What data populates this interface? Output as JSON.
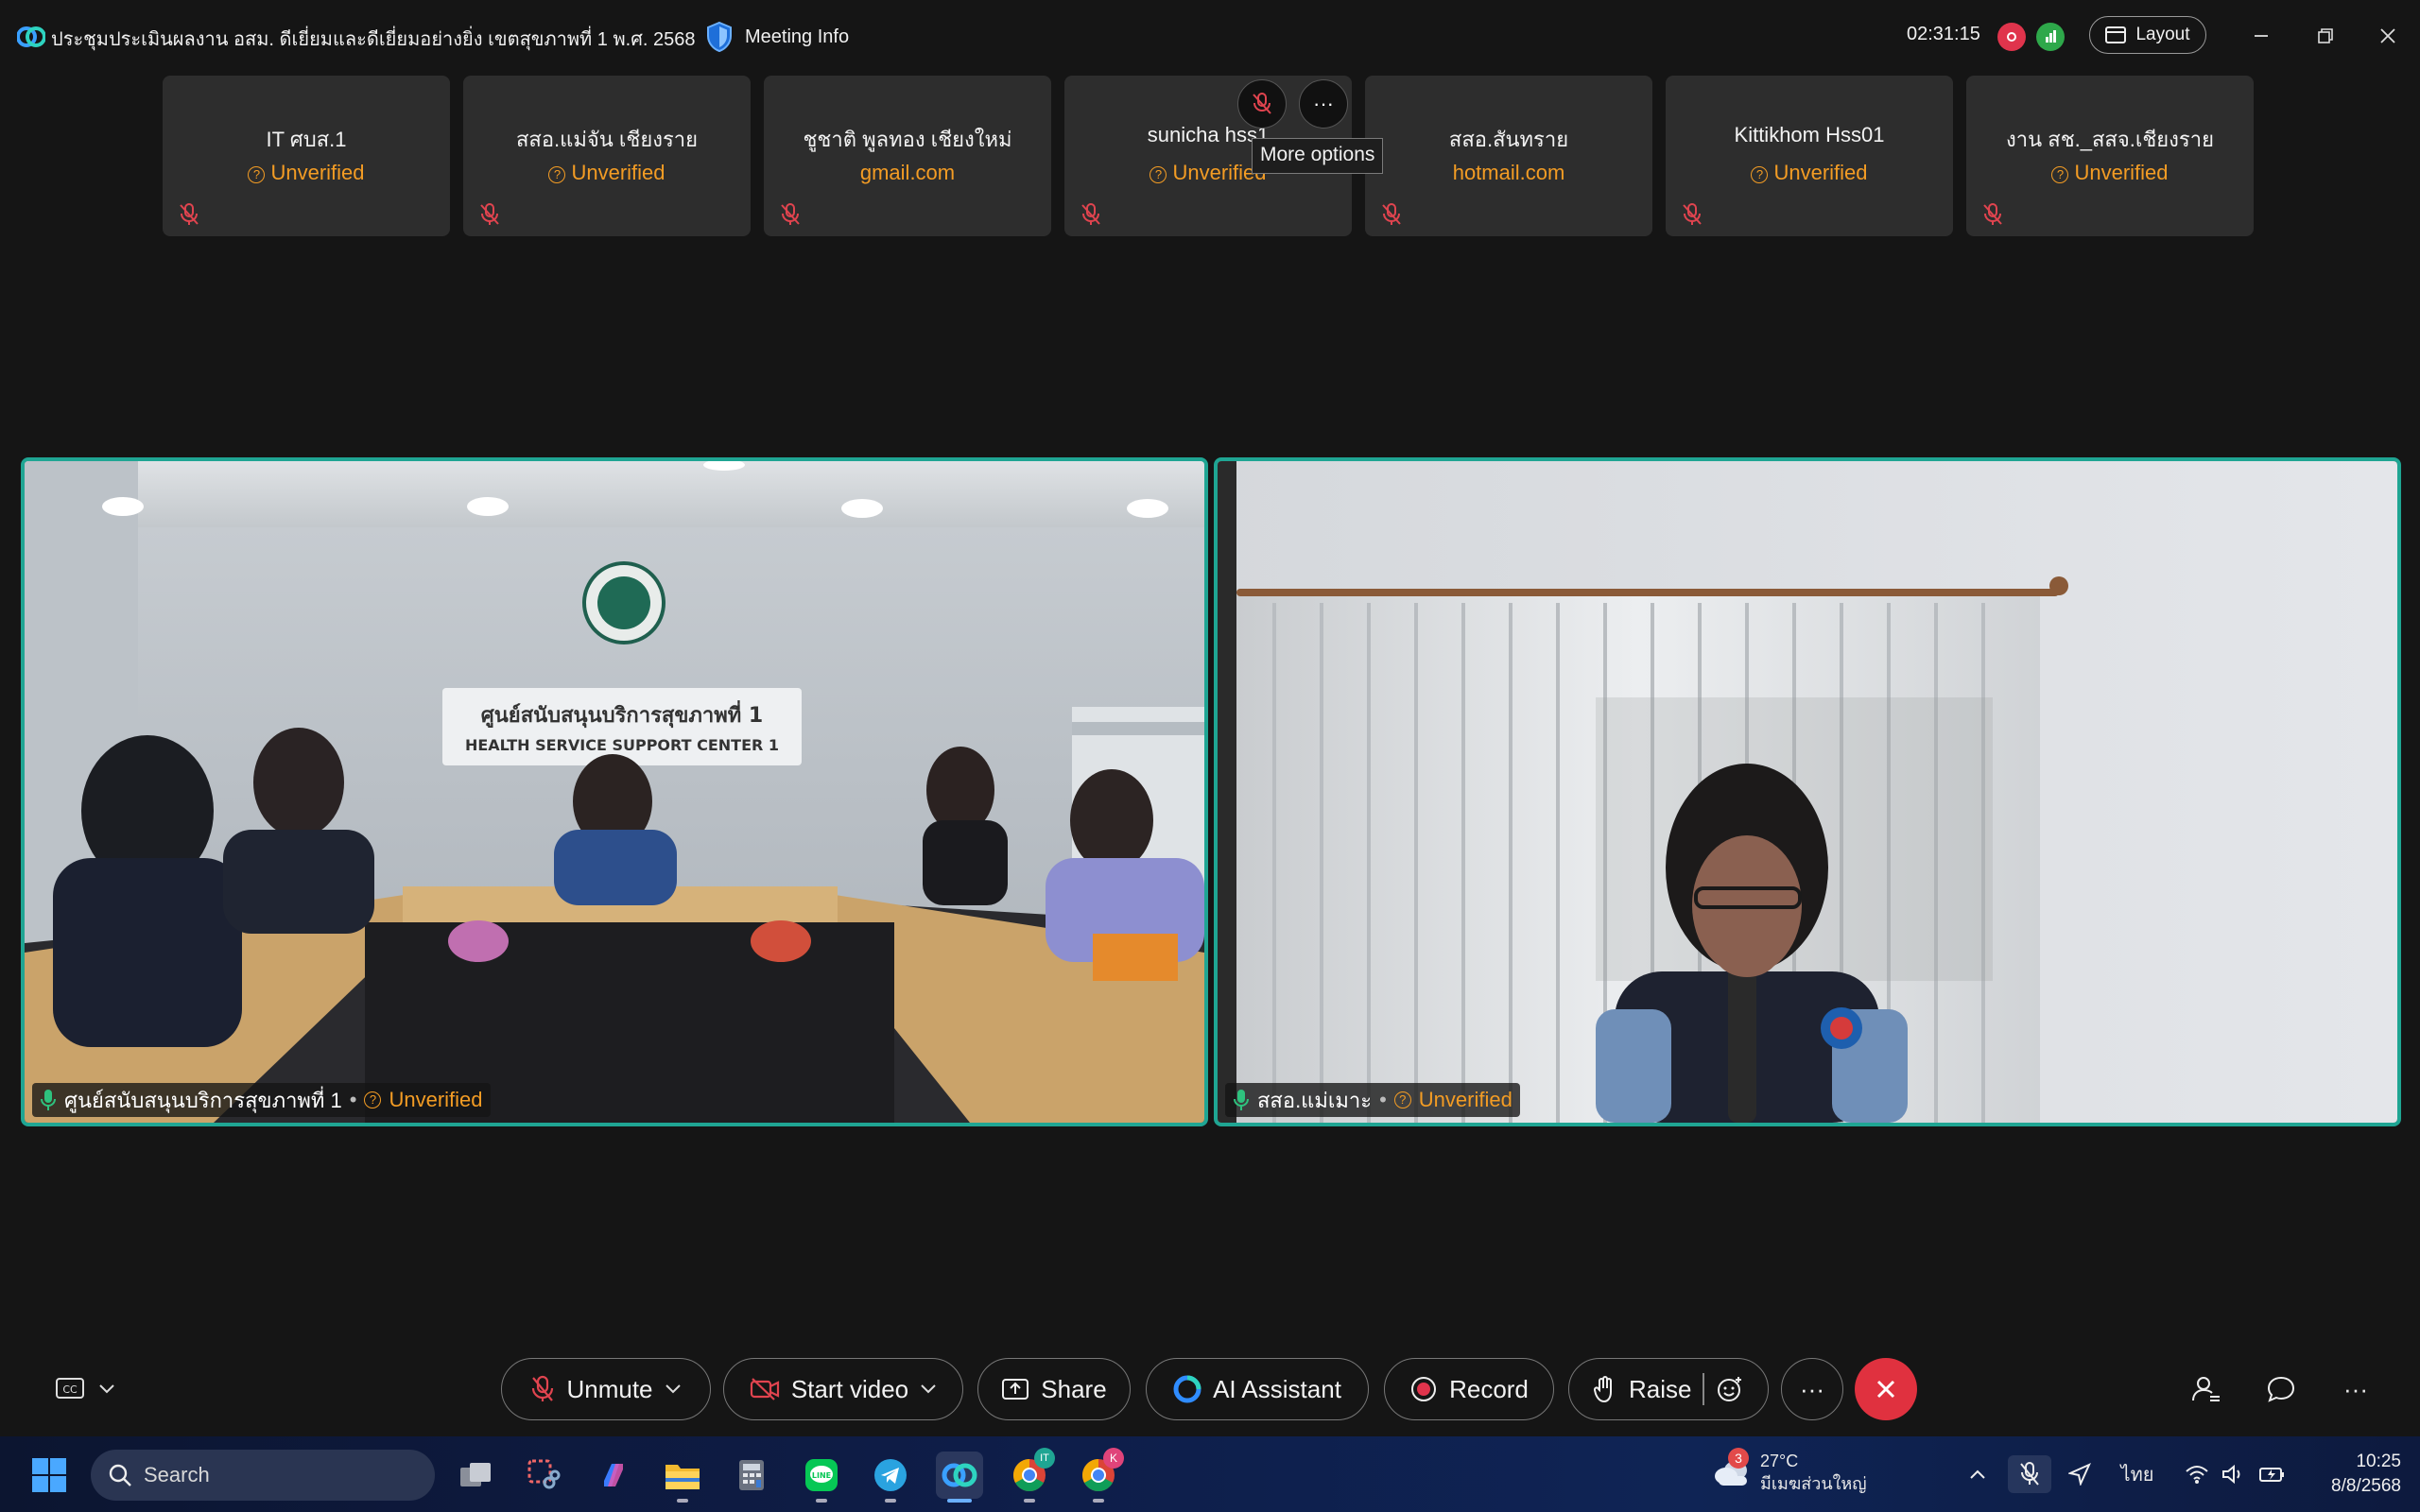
{
  "titlebar": {
    "meeting_title": "ประชุมประเมินผลงาน อสม. ดีเยี่ยมและดีเยี่ยมอย่างยิ่ง เขตสุขภาพที่ 1 พ.ศ. 2568",
    "meeting_info_label": "Meeting Info",
    "timer": "02:31:15",
    "layout_label": "Layout"
  },
  "thumbnails": [
    {
      "name": "IT ศบส.1",
      "status": "Unverified",
      "status_kind": "unverified"
    },
    {
      "name": "สสอ.แม่จัน เชียงราย",
      "status": "Unverified",
      "status_kind": "unverified"
    },
    {
      "name": "ชูชาติ พูลทอง เชียงใหม่",
      "status": "gmail.com",
      "status_kind": "domain"
    },
    {
      "name": "sunicha hss1",
      "status": "Unverified",
      "status_kind": "unverified"
    },
    {
      "name": "สสอ.สันทราย",
      "status": "hotmail.com",
      "status_kind": "domain"
    },
    {
      "name": "Kittikhom Hss01",
      "status": "Unverified",
      "status_kind": "unverified"
    },
    {
      "name": "งาน สช._สสจ.เชียงราย",
      "status": "Unverified",
      "status_kind": "unverified"
    }
  ],
  "tooltip": "More options",
  "videos": [
    {
      "name": "ศูนย์สนับสนุนบริการสุขภาพที่ 1",
      "status": "Unverified",
      "sign_th": "ศูนย์สนับสนุนบริการสุขภาพที่ 1",
      "sign_en": "HEALTH SERVICE SUPPORT CENTER 1"
    },
    {
      "name": "สสอ.แม่เมาะ",
      "status": "Unverified"
    }
  ],
  "controls": {
    "unmute": "Unmute",
    "start_video": "Start video",
    "share": "Share",
    "ai_assistant": "AI Assistant",
    "record": "Record",
    "raise": "Raise",
    "more": "···"
  },
  "taskbar": {
    "search_placeholder": "Search",
    "weather_temp": "27°C",
    "weather_desc": "มีเมฆส่วนใหญ่",
    "weather_badge": "3",
    "language": "ไทย",
    "time": "10:25",
    "date": "8/8/2568",
    "chrome1_badge": "IT",
    "chrome2_badge": "K"
  },
  "colors": {
    "accent_teal": "#1fa593",
    "warning_orange": "#f39c24",
    "leave_red": "#e0313f",
    "record_red": "#e0344c",
    "network_green": "#2ea84a"
  }
}
